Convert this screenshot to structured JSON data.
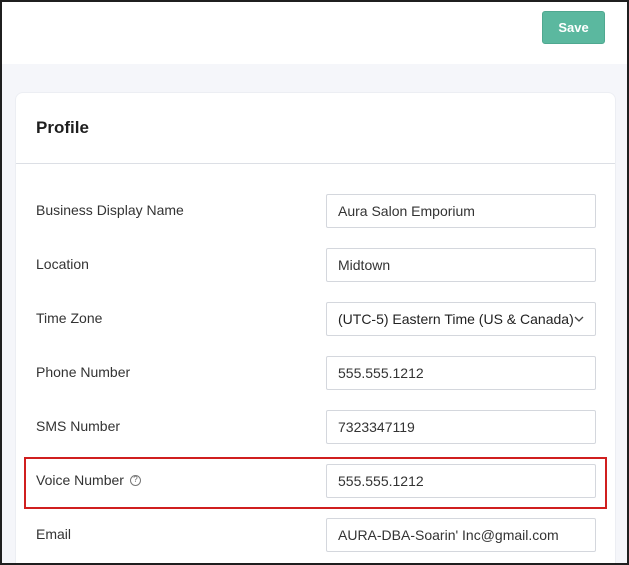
{
  "toolbar": {
    "save_label": "Save"
  },
  "profile": {
    "title": "Profile",
    "fields": {
      "business_display_name": {
        "label": "Business Display Name",
        "value": "Aura Salon Emporium"
      },
      "location": {
        "label": "Location",
        "value": "Midtown"
      },
      "time_zone": {
        "label": "Time Zone",
        "value": "(UTC-5) Eastern Time (US & Canada)"
      },
      "phone_number": {
        "label": "Phone Number",
        "value": "555.555.1212"
      },
      "sms_number": {
        "label": "SMS Number",
        "value": "7323347119"
      },
      "voice_number": {
        "label": "Voice Number",
        "value": "555.555.1212",
        "help_icon": "help-circle-icon"
      },
      "email": {
        "label": "Email",
        "value": "AURA-DBA-Soarin' Inc@gmail.com"
      }
    }
  },
  "colors": {
    "accent": "#5bb89f",
    "highlight": "#d01f1f",
    "page_background": "#f5f6fa"
  }
}
